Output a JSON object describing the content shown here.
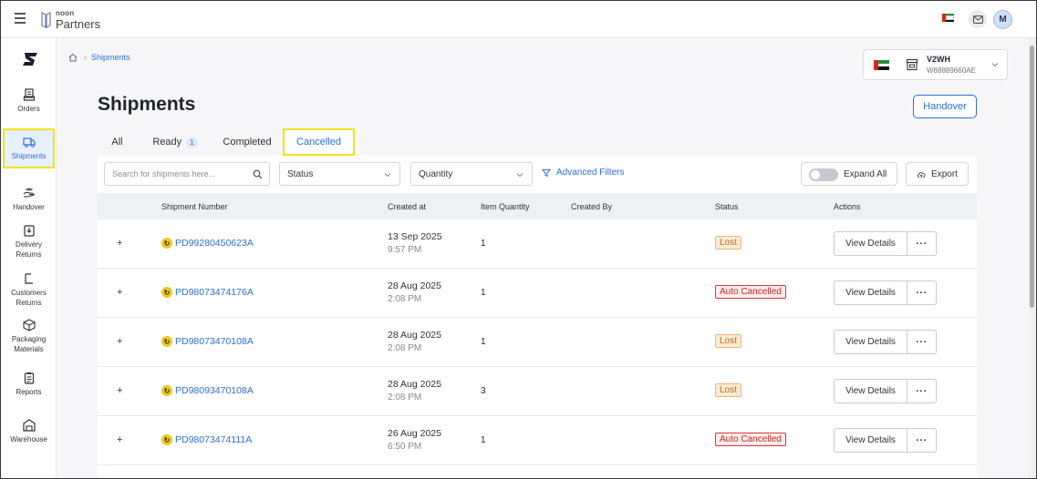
{
  "app": {
    "brand_small": "noon",
    "brand_large": "Partners"
  },
  "header": {
    "avatar_initial": "M"
  },
  "sidebar": {
    "items": [
      {
        "label": "Orders",
        "icon": "orders-icon"
      },
      {
        "label": "Shipments",
        "icon": "truck-icon",
        "active": true
      },
      {
        "label": "Handover",
        "icon": "handover-icon"
      },
      {
        "label": "Delivery Returns",
        "icon": "delivery-returns-icon"
      },
      {
        "label": "Customers Returns",
        "icon": "customer-returns-icon"
      },
      {
        "label": "Packaging Materials",
        "icon": "box-icon"
      },
      {
        "label": "Reports",
        "icon": "reports-icon"
      },
      {
        "label": "Warehouse",
        "icon": "warehouse-icon"
      }
    ]
  },
  "breadcrumb": {
    "current": "Shipments"
  },
  "warehouse": {
    "code": "V2WH",
    "id": "W88889660AE"
  },
  "page": {
    "title": "Shipments",
    "handover_label": "Handover"
  },
  "tabs": [
    {
      "label": "All"
    },
    {
      "label": "Ready",
      "badge": "1"
    },
    {
      "label": "Completed"
    },
    {
      "label": "Cancelled",
      "active": true
    }
  ],
  "toolbar": {
    "search_placeholder": "Search for shipments here...",
    "status_select": "Status",
    "quantity_select": "Quantity",
    "advanced_filters": "Advanced Filters",
    "expand_all": "Expand All",
    "export": "Export"
  },
  "table": {
    "columns": [
      "Shipment Number",
      "Created at",
      "Item Quantity",
      "Created By",
      "Status",
      "Actions"
    ],
    "rows": [
      {
        "shipment": "PD99280450623A",
        "date": "13 Sep 2025",
        "time": "9:57 PM",
        "qty": "1",
        "created_by": "",
        "status": "Lost"
      },
      {
        "shipment": "PD98073474176A",
        "date": "28 Aug 2025",
        "time": "2:08 PM",
        "qty": "1",
        "created_by": "",
        "status": "Auto Cancelled"
      },
      {
        "shipment": "PD98073470108A",
        "date": "28 Aug 2025",
        "time": "2:08 PM",
        "qty": "1",
        "created_by": "",
        "status": "Lost"
      },
      {
        "shipment": "PD98093470108A",
        "date": "28 Aug 2025",
        "time": "2:08 PM",
        "qty": "3",
        "created_by": "",
        "status": "Lost"
      },
      {
        "shipment": "PD98073474111A",
        "date": "26 Aug 2025",
        "time": "6:50 PM",
        "qty": "1",
        "created_by": "",
        "status": "Auto Cancelled"
      }
    ],
    "view_details_label": "View Details",
    "more_label": "···",
    "expand_label": "+"
  },
  "colors": {
    "accent": "#2d6fd8",
    "highlight": "#f1e21b",
    "lost": "#c26a10",
    "auto_cancelled": "#c92727"
  }
}
